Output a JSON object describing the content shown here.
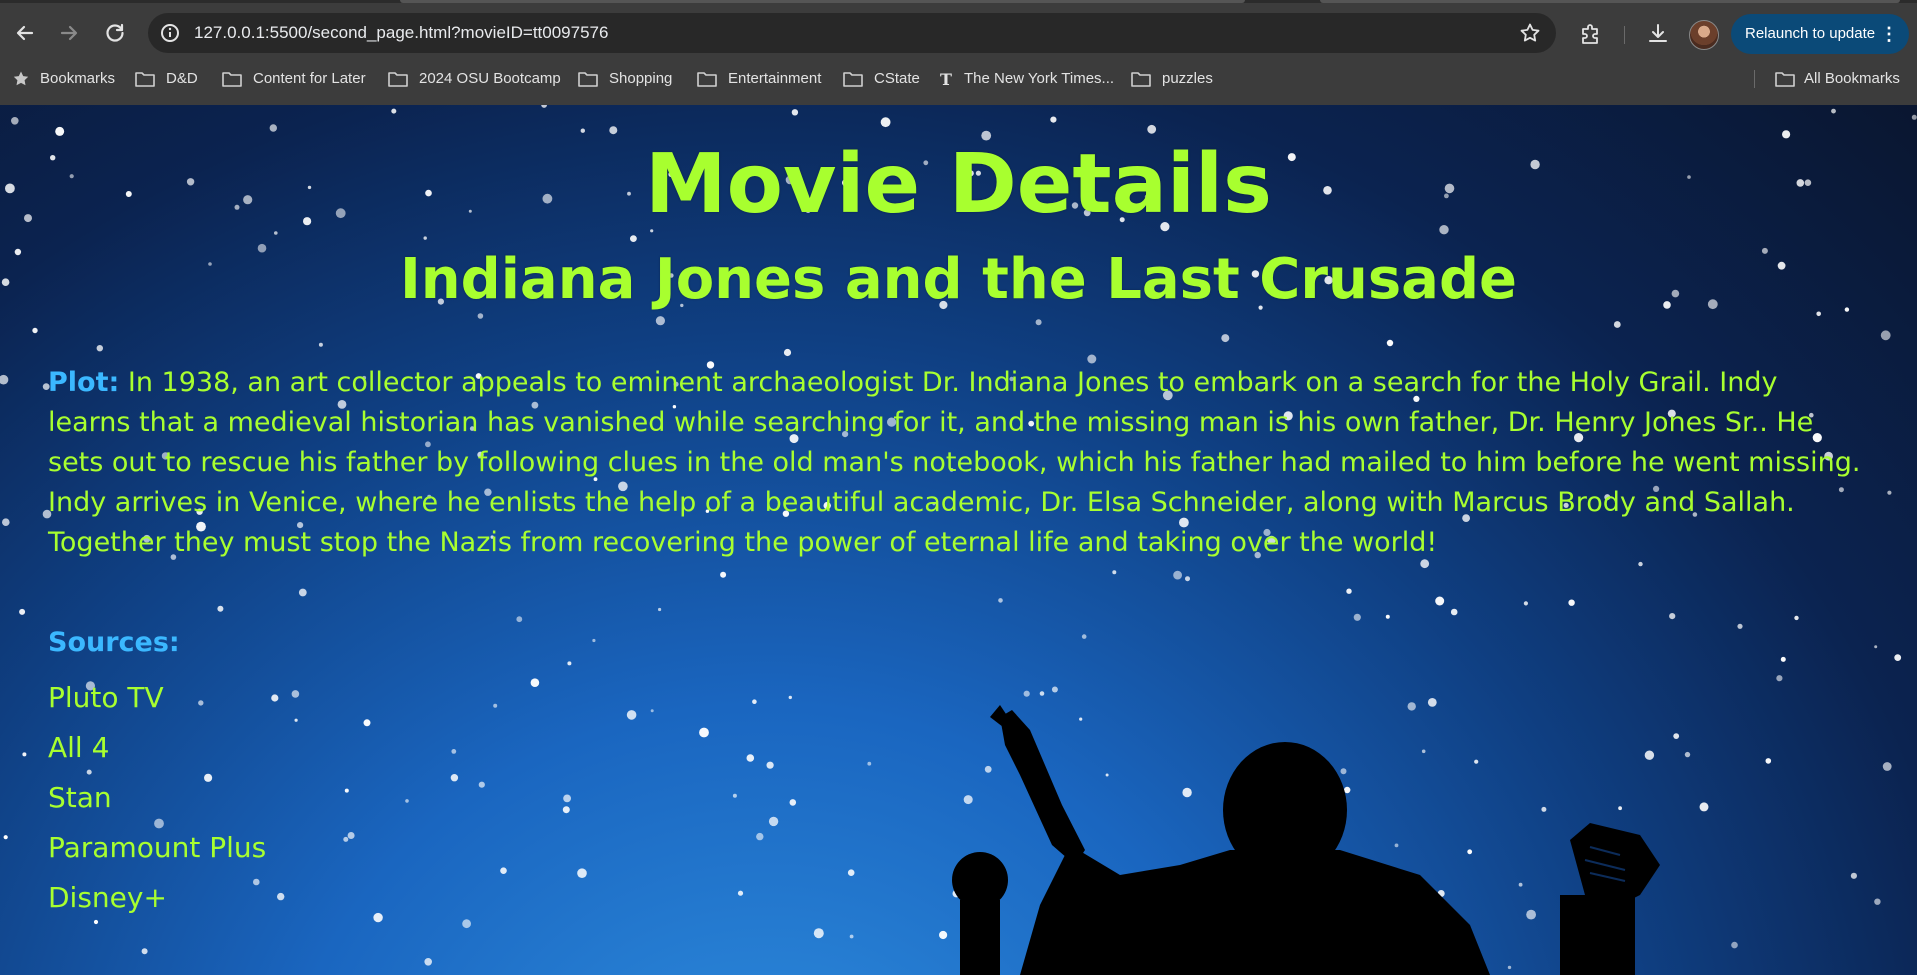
{
  "browser": {
    "url": "127.0.0.1:5500/second_page.html?movieID=tt0097576",
    "relaunch_label": "Relaunch to update",
    "bookmarks": [
      {
        "label": "Bookmarks",
        "icon": "star-icon"
      },
      {
        "label": "D&D",
        "icon": "folder-icon"
      },
      {
        "label": "Content for Later",
        "icon": "folder-icon"
      },
      {
        "label": "2024 OSU Bootcamp",
        "icon": "folder-icon"
      },
      {
        "label": "Shopping",
        "icon": "folder-icon"
      },
      {
        "label": "Entertainment",
        "icon": "folder-icon"
      },
      {
        "label": "CState",
        "icon": "folder-icon"
      },
      {
        "label": "The New York Times...",
        "icon": "nyt-icon"
      },
      {
        "label": "puzzles",
        "icon": "folder-icon"
      }
    ],
    "all_bookmarks_label": "All Bookmarks"
  },
  "page": {
    "heading": "Movie Details",
    "movie_title": "Indiana Jones and the Last Crusade",
    "plot_label": "Plot:",
    "plot_text": "In 1938, an art collector appeals to eminent archaeologist Dr. Indiana Jones to embark on a search for the Holy Grail. Indy learns that a medieval historian has vanished while searching for it, and the missing man is his own father, Dr. Henry Jones Sr.. He sets out to rescue his father by following clues in the old man's notebook, which his father had mailed to him before he went missing. Indy arrives in Venice, where he enlists the help of a beautiful academic, Dr. Elsa Schneider, along with Marcus Brody and Sallah. Together they must stop the Nazis from recovering the power of eternal life and taking over the world!",
    "sources_label": "Sources:",
    "sources": [
      "Pluto TV",
      "All 4",
      "Stan",
      "Paramount Plus",
      "Disney+"
    ]
  },
  "colors": {
    "heading_text": "#a8ff2f",
    "label_text": "#3bb8ff",
    "chrome_bg": "#3c3c3c",
    "relaunch_bg": "#0b4a78"
  }
}
